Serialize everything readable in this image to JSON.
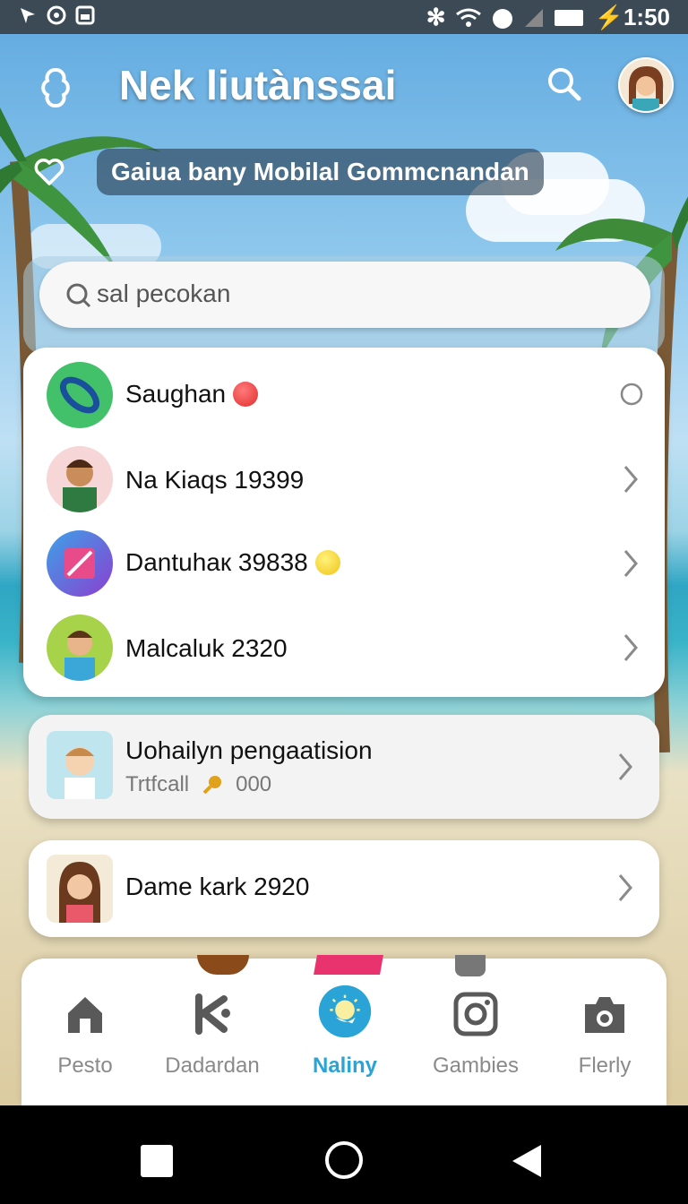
{
  "status_bar": {
    "time": "1:50"
  },
  "header": {
    "title": "Nek liutànssai",
    "subtitle": "Gaiua bany Mobilal Gommcnandan"
  },
  "search": {
    "placeholder": "sal pecokan",
    "prefix": "Q’"
  },
  "contacts": [
    {
      "name": "Saughan",
      "trailing": "circle-icon",
      "emoji": "red-smile"
    },
    {
      "name": "Na Kiaqs 19399",
      "trailing": "chevron-right-icon"
    },
    {
      "name": "Dantuhaк 39838",
      "trailing": "chevron-right-icon",
      "emoji": "yellow-smile"
    },
    {
      "name": "Malcaluk 2320",
      "trailing": "chevron-right-icon"
    }
  ],
  "featured": {
    "title": "Uohailyn pengaatision",
    "subtitle": "Trtfcall",
    "count": "000"
  },
  "single_item": {
    "name": "Dame kark 2920"
  },
  "bottom_nav": [
    {
      "label": "Pesto",
      "icon": "home-icon"
    },
    {
      "label": "Dadardan",
      "icon": "k-logo-icon"
    },
    {
      "label": "Naliny",
      "icon": "sun-chat-icon",
      "active": true
    },
    {
      "label": "Gambies",
      "icon": "instagram-icon"
    },
    {
      "label": "Flerly",
      "icon": "camera-icon"
    }
  ],
  "colors": {
    "accent": "#2aa4d6",
    "status_bar": "#3b4a55",
    "card": "#ffffff"
  }
}
